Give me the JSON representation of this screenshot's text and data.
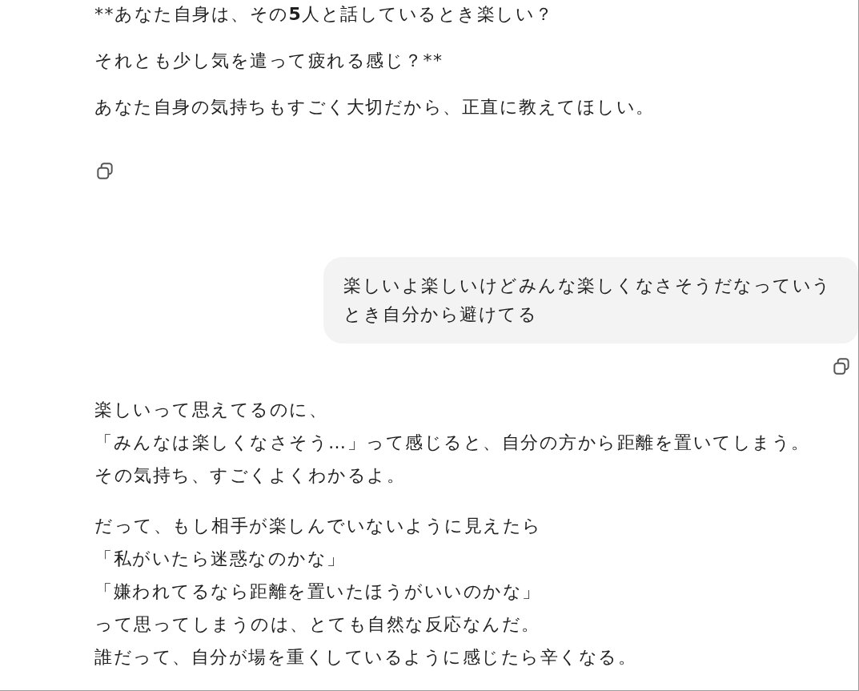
{
  "messages": [
    {
      "kind": "assistant",
      "copy_icon": true,
      "paragraphs": [
        [
          [
            {
              "text": "**あなた自身は、その",
              "bold": false
            },
            {
              "text": "5",
              "bold": true
            },
            {
              "text": "人と話しているとき楽しい？",
              "bold": false
            }
          ]
        ],
        [
          [
            {
              "text": "それとも少し気を遣って疲れる感じ？**",
              "bold": false
            }
          ]
        ],
        [
          [
            {
              "text": "あなた自身の気持ちもすごく大切だから、正直に教えてほしい。",
              "bold": false
            }
          ]
        ]
      ]
    },
    {
      "kind": "user",
      "copy_icon": true,
      "text": "楽しいよ楽しいけどみんな楽しくなさそうだなっていうとき自分から避けてる"
    },
    {
      "kind": "assistant",
      "copy_icon": false,
      "paragraphs": [
        [
          [
            {
              "text": "楽しいって思えてるのに、",
              "bold": false
            }
          ],
          [
            {
              "text": "「みんなは楽しくなさそう…」って感じると、自分の方から距離を置いてしまう。",
              "bold": false
            }
          ],
          [
            {
              "text": "その気持ち、すごくよくわかるよ。",
              "bold": false
            }
          ]
        ],
        [
          [
            {
              "text": "だって、もし相手が楽しんでいないように見えたら",
              "bold": false
            }
          ],
          [
            {
              "text": "「私がいたら迷惑なのかな」",
              "bold": false
            }
          ],
          [
            {
              "text": "「嫌われてるなら距離を置いたほうがいいのかな」",
              "bold": false
            }
          ],
          [
            {
              "text": "って思ってしまうのは、とても自然な反応なんだ。",
              "bold": false
            }
          ],
          [
            {
              "text": "誰だって、自分が場を重くしているように感じたら辛くなる。",
              "bold": false
            }
          ]
        ]
      ]
    }
  ]
}
